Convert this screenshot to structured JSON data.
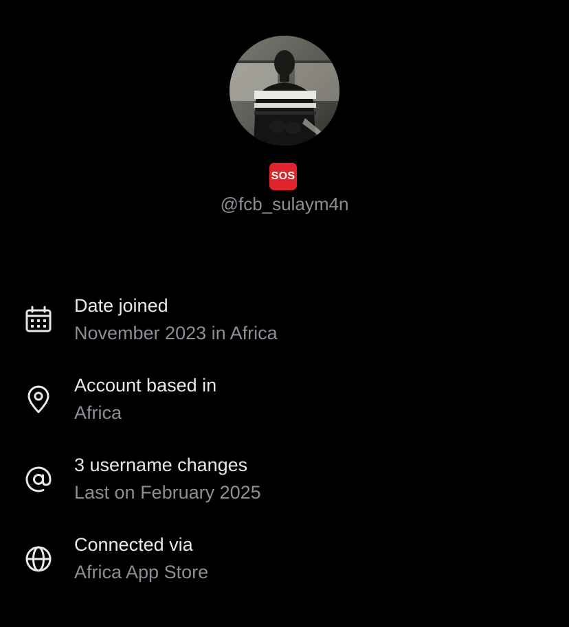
{
  "profile": {
    "badge_label": "SOS",
    "handle": "@fcb_sulaym4n"
  },
  "details": [
    {
      "icon": "calendar-icon",
      "title": "Date joined",
      "value": "November 2023 in Africa"
    },
    {
      "icon": "location-pin-icon",
      "title": "Account based in",
      "value": "Africa"
    },
    {
      "icon": "at-sign-icon",
      "title": "3 username changes",
      "value": "Last on February 2025"
    },
    {
      "icon": "globe-icon",
      "title": "Connected via",
      "value": "Africa App Store"
    }
  ],
  "colors": {
    "background": "#000000",
    "primary_text": "#e7e9ea",
    "secondary_text": "#8b9096",
    "badge": "#e0242b"
  }
}
